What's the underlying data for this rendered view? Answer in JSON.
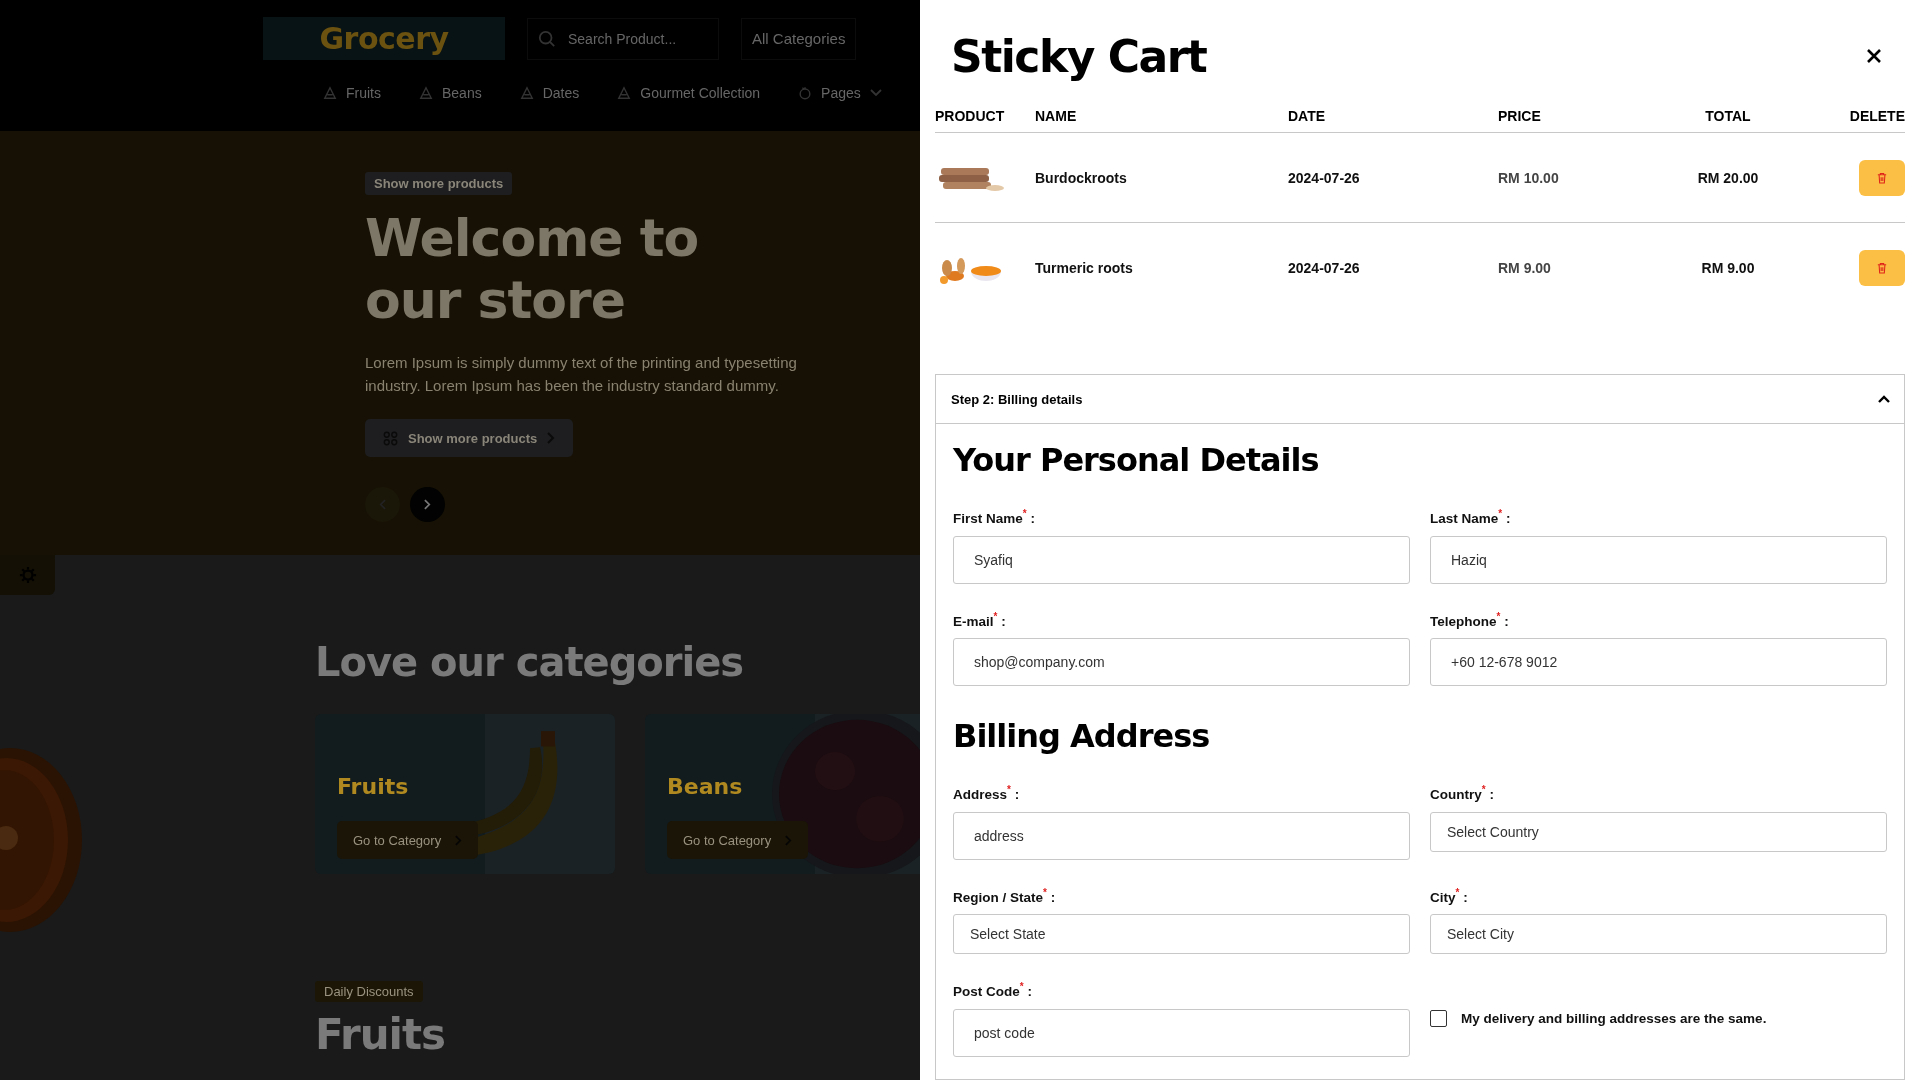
{
  "header": {
    "logo": "Grocery",
    "search": {
      "placeholder": "Search Product..."
    },
    "category_select": "All Categories",
    "nav": [
      {
        "label": "Fruits",
        "kind": "link"
      },
      {
        "label": "Beans",
        "kind": "link"
      },
      {
        "label": "Dates",
        "kind": "link"
      },
      {
        "label": "Gourmet Collection",
        "kind": "link"
      },
      {
        "label": "Pages",
        "kind": "dropdown"
      }
    ]
  },
  "hero": {
    "tag": "Show more products",
    "title_lines": [
      "Welcome to",
      "our store"
    ],
    "text": "Lorem Ipsum is simply dummy text of the printing and typesetting industry. Lorem Ipsum has been the industry standard dummy.",
    "button": "Show more products",
    "arrows": [
      {
        "kind": "prev",
        "disabled": true
      },
      {
        "kind": "next",
        "disabled": false
      }
    ]
  },
  "categories": {
    "title": "Love our categories",
    "cards": [
      {
        "name": "Fruits",
        "button": "Go to Category",
        "kind": "bananas"
      },
      {
        "name": "Beans",
        "button": "Go to Category",
        "kind": "beans"
      }
    ]
  },
  "discounts": {
    "tag": "Daily Discounts",
    "title_lines": [
      "Fruits"
    ]
  },
  "cart": {
    "title": "Sticky Cart",
    "columns": [
      "PRODUCT",
      "NAME",
      "DATE",
      "PRICE",
      "TOTAL",
      "DELETE"
    ],
    "rows": [
      {
        "kind": "burdock",
        "name": "Burdockroots",
        "date": "2024-07-26",
        "price": "RM 10.00",
        "total": "RM 20.00"
      },
      {
        "kind": "turmeric",
        "name": "Turmeric roots",
        "date": "2024-07-26",
        "price": "RM 9.00",
        "total": "RM 9.00"
      }
    ]
  },
  "billing": {
    "step": "Step 2: Billing details",
    "expanded": true,
    "sections": [
      {
        "title": "Your Personal Details",
        "fields": [
          {
            "kind": "input",
            "label": "First Name$^{*}$ :",
            "value": "Syafiq"
          },
          {
            "kind": "input",
            "label": "Last Name$^{*}$ :",
            "value": "Haziq"
          },
          {
            "kind": "input",
            "label": "E-mail$^{*}$ :",
            "value": "shop@company.com"
          },
          {
            "kind": "input",
            "label": "Telephone$^{*}$ :",
            "value": "+60 12-678 9012"
          }
        ]
      },
      {
        "title": "Billing Address",
        "fields": [
          {
            "kind": "input",
            "label": "Address$^{*}$ :",
            "placeholder": "address"
          },
          {
            "kind": "select",
            "label": "Country$^{*}$ :",
            "value": "Select Country"
          },
          {
            "kind": "select",
            "label": "Region / State$^{*}$ :",
            "value": "Select State"
          },
          {
            "kind": "select",
            "label": "City$^{*}$ :",
            "value": "Select City"
          },
          {
            "kind": "input",
            "label": "Post Code$^{*}$ :",
            "placeholder": "post code"
          },
          {
            "kind": "checkbox",
            "label": "My delivery and billing addresses are the same.",
            "checked": false
          }
        ]
      }
    ]
  }
}
